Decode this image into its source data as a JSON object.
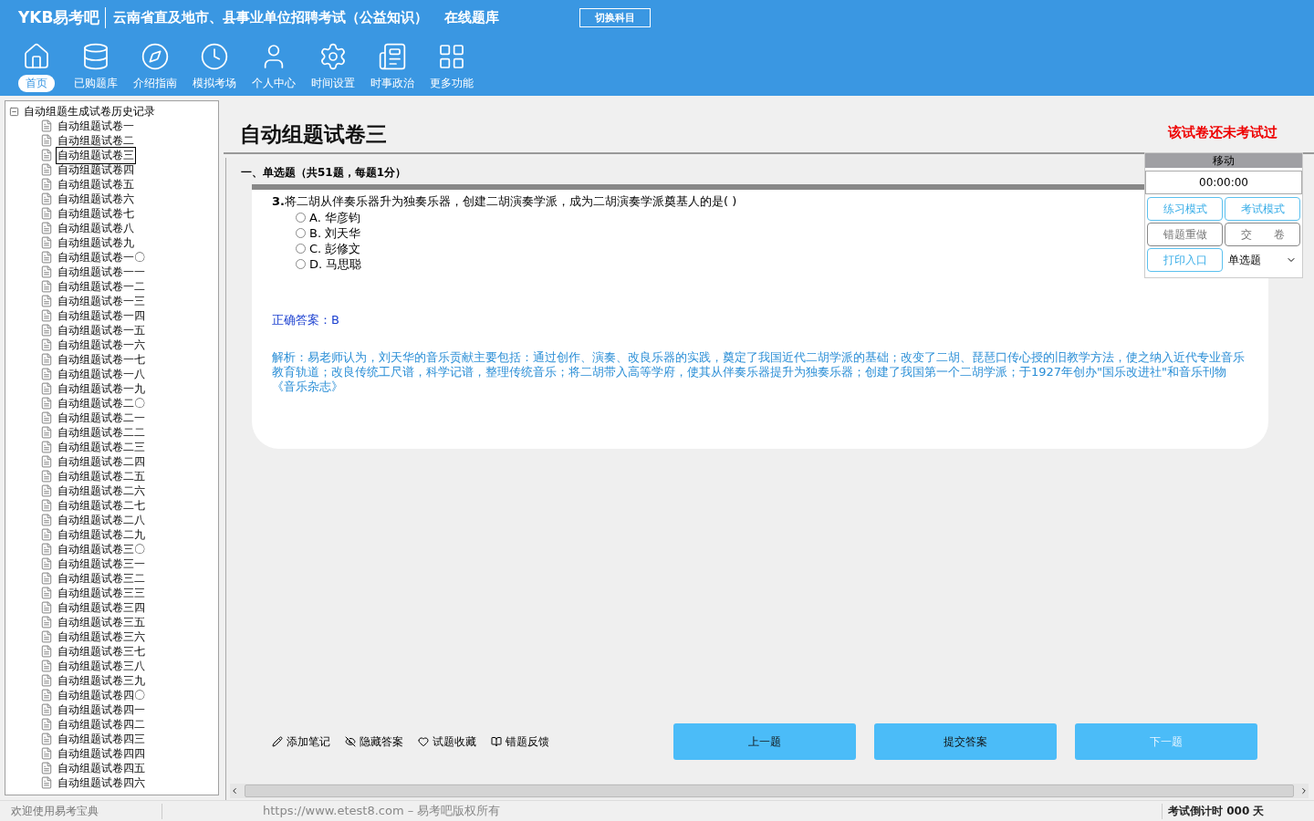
{
  "header": {
    "logo": "YKB易考吧",
    "title": "云南省直及地市、县事业单位招聘考试（公益知识）",
    "subtitle": "在线题库",
    "switch_button": "切换科目"
  },
  "nav": [
    {
      "label": "首页",
      "selected": true
    },
    {
      "label": "已购题库",
      "selected": false
    },
    {
      "label": "介绍指南",
      "selected": false
    },
    {
      "label": "模拟考场",
      "selected": false
    },
    {
      "label": "个人中心",
      "selected": false
    },
    {
      "label": "时间设置",
      "selected": false
    },
    {
      "label": "时事政治",
      "selected": false
    },
    {
      "label": "更多功能",
      "selected": false
    }
  ],
  "tree": {
    "label": "自动组题生成试卷历史记录",
    "expanded": true,
    "children": [
      {
        "label": "自动组题试卷一",
        "selected": false
      },
      {
        "label": "自动组题试卷二",
        "selected": false
      },
      {
        "label": "自动组题试卷三",
        "selected": true
      },
      {
        "label": "自动组题试卷四",
        "selected": false
      },
      {
        "label": "自动组题试卷五",
        "selected": false
      },
      {
        "label": "自动组题试卷六",
        "selected": false
      },
      {
        "label": "自动组题试卷七",
        "selected": false
      },
      {
        "label": "自动组题试卷八",
        "selected": false
      },
      {
        "label": "自动组题试卷九",
        "selected": false
      },
      {
        "label": "自动组题试卷一〇",
        "selected": false
      },
      {
        "label": "自动组题试卷一一",
        "selected": false
      },
      {
        "label": "自动组题试卷一二",
        "selected": false
      },
      {
        "label": "自动组题试卷一三",
        "selected": false
      },
      {
        "label": "自动组题试卷一四",
        "selected": false
      },
      {
        "label": "自动组题试卷一五",
        "selected": false
      },
      {
        "label": "自动组题试卷一六",
        "selected": false
      },
      {
        "label": "自动组题试卷一七",
        "selected": false
      },
      {
        "label": "自动组题试卷一八",
        "selected": false
      },
      {
        "label": "自动组题试卷一九",
        "selected": false
      },
      {
        "label": "自动组题试卷二〇",
        "selected": false
      },
      {
        "label": "自动组题试卷二一",
        "selected": false
      },
      {
        "label": "自动组题试卷二二",
        "selected": false
      },
      {
        "label": "自动组题试卷二三",
        "selected": false
      },
      {
        "label": "自动组题试卷二四",
        "selected": false
      },
      {
        "label": "自动组题试卷二五",
        "selected": false
      },
      {
        "label": "自动组题试卷二六",
        "selected": false
      },
      {
        "label": "自动组题试卷二七",
        "selected": false
      },
      {
        "label": "自动组题试卷二八",
        "selected": false
      },
      {
        "label": "自动组题试卷二九",
        "selected": false
      },
      {
        "label": "自动组题试卷三〇",
        "selected": false
      },
      {
        "label": "自动组题试卷三一",
        "selected": false
      },
      {
        "label": "自动组题试卷三二",
        "selected": false
      },
      {
        "label": "自动组题试卷三三",
        "selected": false
      },
      {
        "label": "自动组题试卷三四",
        "selected": false
      },
      {
        "label": "自动组题试卷三五",
        "selected": false
      },
      {
        "label": "自动组题试卷三六",
        "selected": false
      },
      {
        "label": "自动组题试卷三七",
        "selected": false
      },
      {
        "label": "自动组题试卷三八",
        "selected": false
      },
      {
        "label": "自动组题试卷三九",
        "selected": false
      },
      {
        "label": "自动组题试卷四〇",
        "selected": false
      },
      {
        "label": "自动组题试卷四一",
        "selected": false
      },
      {
        "label": "自动组题试卷四二",
        "selected": false
      },
      {
        "label": "自动组题试卷四三",
        "selected": false
      },
      {
        "label": "自动组题试卷四四",
        "selected": false
      },
      {
        "label": "自动组题试卷四五",
        "selected": false
      },
      {
        "label": "自动组题试卷四六",
        "selected": false
      }
    ]
  },
  "paper": {
    "title": "自动组题试卷三",
    "status": "该试卷还未考试过",
    "section": "一、单选题（共51题，每题1分）"
  },
  "question": {
    "number": "3.",
    "text": "将二胡从伴奏乐器升为独奏乐器，创建二胡演奏学派，成为二胡演奏学派奠基人的是( )",
    "options": [
      {
        "label": "A.",
        "text": "华彦钧",
        "selected": false
      },
      {
        "label": "B.",
        "text": "刘天华",
        "selected": false
      },
      {
        "label": "C.",
        "text": "彭修文",
        "selected": false
      },
      {
        "label": "D.",
        "text": "马思聪",
        "selected": false
      }
    ],
    "answer_label": "正确答案：",
    "answer": "B",
    "analysis": "解析：易老师认为，刘天华的音乐贡献主要包括：通过创作、演奏、改良乐器的实践，奠定了我国近代二胡学派的基础；改变了二胡、琵琶口传心授的旧教学方法，使之纳入近代专业音乐教育轨道；改良传统工尺谱，科学记谱，整理传统音乐；将二胡带入高等学府，使其从伴奏乐器提升为独奏乐器；创建了我国第一个二胡学派；于1927年创办\"国乐改进社\"和音乐刊物《音乐杂志》"
  },
  "side_panel": {
    "title": "移动",
    "timer": "00:00:00",
    "buttons": [
      {
        "label": "练习模式",
        "kind": "accent"
      },
      {
        "label": "考试模式",
        "kind": "accent"
      },
      {
        "label": "错题重做",
        "kind": "plain"
      },
      {
        "label": "交　　卷",
        "kind": "plain"
      },
      {
        "label": "打印入口",
        "kind": "accent"
      }
    ],
    "type_select": "单选题"
  },
  "tools": [
    {
      "label": "添加笔记"
    },
    {
      "label": "隐藏答案"
    },
    {
      "label": "试题收藏"
    },
    {
      "label": "错题反馈"
    }
  ],
  "nav_buttons": [
    {
      "label": "上一题",
      "disabled": false
    },
    {
      "label": "提交答案",
      "disabled": false
    },
    {
      "label": "下一题",
      "disabled": true
    }
  ],
  "status_bar": {
    "welcome": "欢迎使用易考宝典",
    "copyright": "https://www.etest8.com – 易考吧版权所有",
    "countdown": "考试倒计时 000 天"
  }
}
